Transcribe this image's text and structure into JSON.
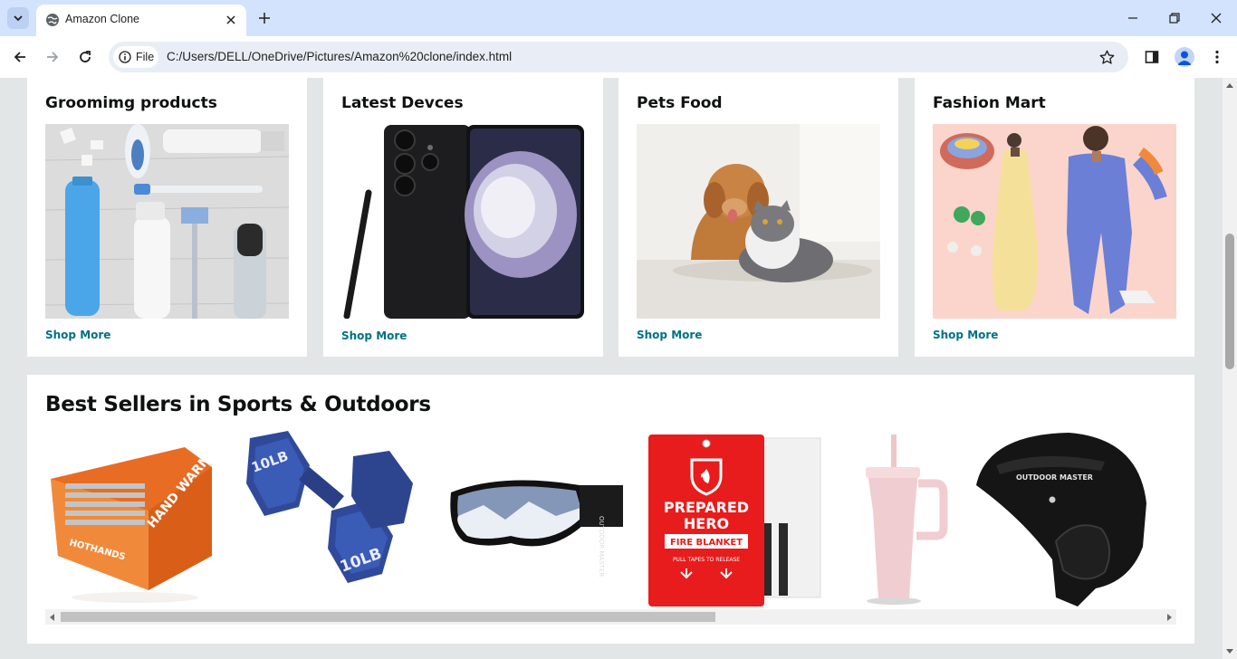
{
  "browser": {
    "tab_title": "Amazon Clone",
    "url_chip": "File",
    "url": "C:/Users/DELL/OneDrive/Pictures/Amazon%20clone/index.html"
  },
  "cards": [
    {
      "title": "Groomimg products",
      "link": "Shop More"
    },
    {
      "title": "Latest Devces",
      "link": "Shop More"
    },
    {
      "title": "Pets Food",
      "link": "Shop More"
    },
    {
      "title": "Fashion Mart",
      "link": "Shop More"
    }
  ],
  "best_sellers": {
    "title": "Best Sellers in Sports & Outdoors",
    "products": [
      {
        "name": "hand-warmers",
        "label_1": "HOTHANDS",
        "label_2": "HAND WARMERS"
      },
      {
        "name": "dumbbells",
        "label_1": "10LB",
        "label_2": "10LB"
      },
      {
        "name": "ski-goggles",
        "label_1": "OUTDOOR MASTER"
      },
      {
        "name": "fire-blanket",
        "label_1": "PREPARED",
        "label_2": "HERO",
        "label_3": "FIRE BLANKET",
        "label_4": "PULL TAPES TO RELEASE"
      },
      {
        "name": "tumbler"
      },
      {
        "name": "ski-helmet",
        "label_1": "OUTDOOR MASTER"
      }
    ]
  },
  "colors": {
    "tab_strip": "#d3e3fd",
    "page_bg": "#e3e6e6",
    "link": "#007185",
    "heading": "#0f1111"
  }
}
